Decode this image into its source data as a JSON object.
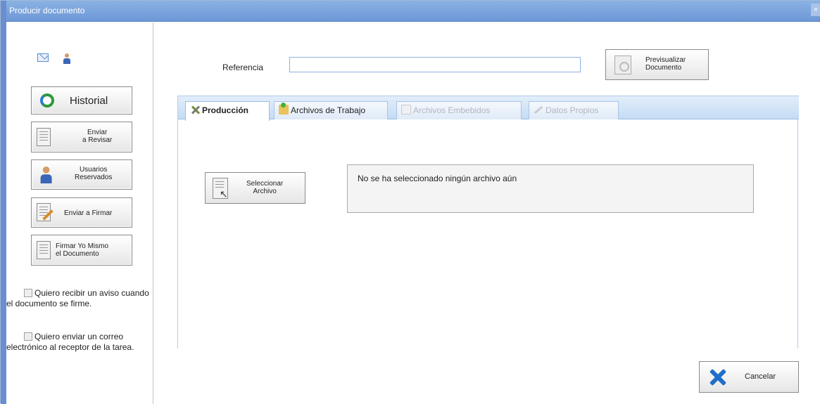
{
  "window": {
    "title": "Producir documento",
    "close_label": "×"
  },
  "sidebar": {
    "historial_label": "Historial",
    "enviar_revisar_label": "Enviar\na Revisar",
    "usuarios_reservados_label": "Usuarios\nReservados",
    "enviar_firmar_label": "Enviar a Firmar",
    "firmar_yo_mismo_label": "Firmar Yo Mismo\nel Documento",
    "check_aviso_label": "Quiero recibir un aviso cuando el documento se firme.",
    "check_correo_label": "Quiero enviar un correo electrónico al receptor de la tarea."
  },
  "main": {
    "referencia_label": "Referencia",
    "referencia_value": "",
    "previsualizar_label": "Previsualizar\nDocumento",
    "tabs": [
      {
        "label": "Producción",
        "state": "active",
        "icon": "tools-icon"
      },
      {
        "label": "Archivos de Trabajo",
        "state": "enabled",
        "icon": "folder-icon"
      },
      {
        "label": "Archivos Embebidos",
        "state": "disabled",
        "icon": "embedded-icon"
      },
      {
        "label": "Datos Propios",
        "state": "disabled",
        "icon": "pen-icon"
      }
    ],
    "seleccionar_label": "Seleccionar\nArchivo",
    "file_status": "No se ha seleccionado ningún archivo aún",
    "cancelar_label": "Cancelar"
  }
}
